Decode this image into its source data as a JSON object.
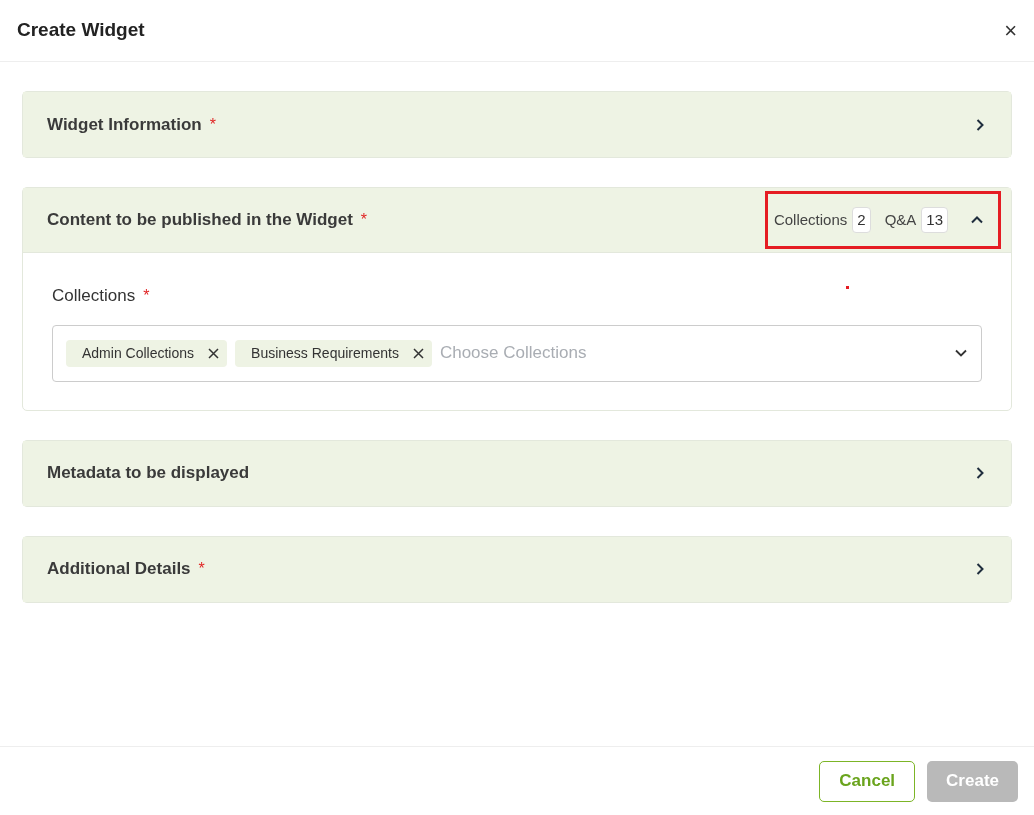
{
  "dialog": {
    "title": "Create Widget",
    "close": "×"
  },
  "sections": [
    {
      "title": "Widget Information",
      "required_mark": "*",
      "expanded": false
    },
    {
      "title": "Content to be published in the Widget",
      "required_mark": "*",
      "expanded": true,
      "highlighted": true,
      "counts": [
        {
          "label": "Collections",
          "value": "2"
        },
        {
          "label": "Q&A",
          "value": "13"
        }
      ],
      "field": {
        "label": "Collections",
        "required_mark": "*",
        "placeholder": "Choose Collections",
        "tags": [
          "Admin Collections",
          "Business Requirements"
        ]
      }
    },
    {
      "title": "Metadata to be displayed",
      "expanded": false
    },
    {
      "title": "Additional Details",
      "required_mark": "*",
      "expanded": false
    }
  ],
  "buttons": [
    {
      "label": "Cancel",
      "disabled": false,
      "kind": "secondary"
    },
    {
      "label": "Create",
      "disabled": true,
      "kind": "primary"
    }
  ]
}
